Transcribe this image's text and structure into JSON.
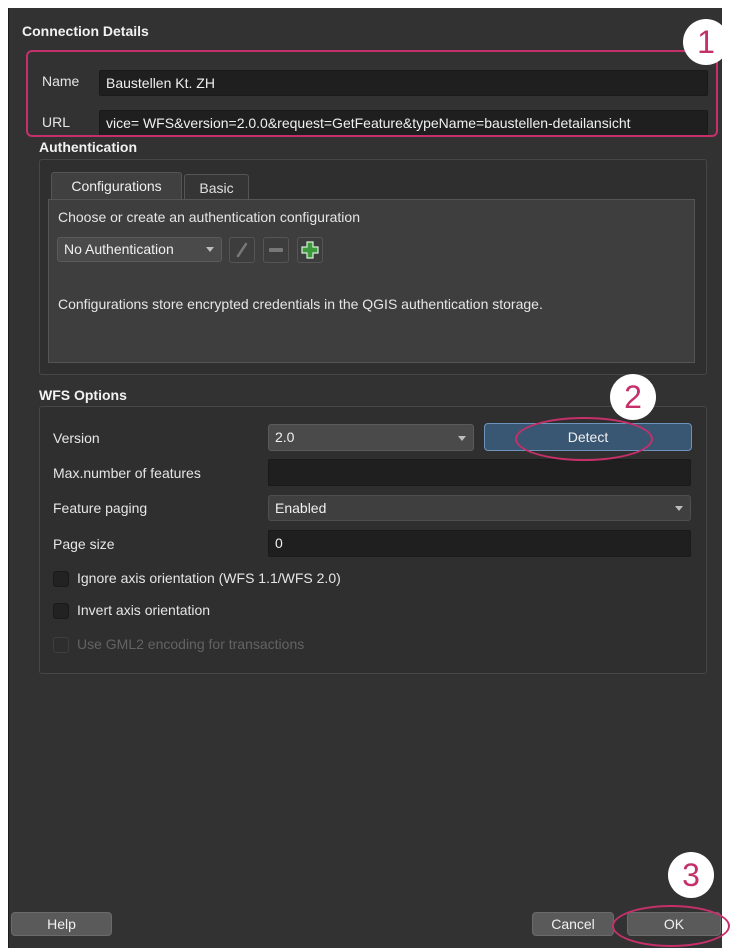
{
  "connection": {
    "title": "Connection Details",
    "name_label": "Name",
    "name_value": "Baustellen Kt. ZH",
    "url_label": "URL",
    "url_value": "vice= WFS&version=2.0.0&request=GetFeature&typeName=baustellen-detailansicht"
  },
  "authentication": {
    "title": "Authentication",
    "tabs": [
      {
        "label": "Configurations",
        "active": true
      },
      {
        "label": "Basic",
        "active": false
      }
    ],
    "prompt": "Choose or create an authentication configuration",
    "selected_config": "No Authentication",
    "tools": [
      "edit-icon",
      "remove-icon",
      "add-icon"
    ],
    "info": "Configurations store encrypted credentials in the QGIS authentication storage."
  },
  "wfs": {
    "title": "WFS Options",
    "version_label": "Version",
    "version_value": "2.0",
    "detect_label": "Detect",
    "max_features_label": "Max.number of features",
    "max_features_value": "",
    "paging_label": "Feature paging",
    "paging_value": "Enabled",
    "page_size_label": "Page size",
    "page_size_value": "0",
    "checks": [
      {
        "label": "Ignore axis orientation (WFS 1.1/WFS 2.0)",
        "checked": false,
        "enabled": true
      },
      {
        "label": "Invert axis orientation",
        "checked": false,
        "enabled": true
      },
      {
        "label": "Use GML2 encoding for transactions",
        "checked": false,
        "enabled": false
      }
    ]
  },
  "footer": {
    "help": "Help",
    "cancel": "Cancel",
    "ok": "OK"
  },
  "annotations": {
    "one": "1",
    "two": "2",
    "three": "3",
    "color": "#c5306a"
  }
}
